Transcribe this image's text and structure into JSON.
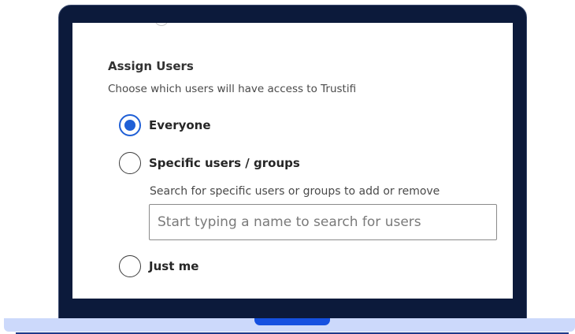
{
  "assign_users": {
    "title": "Assign Users",
    "description": "Choose which users will have access to Trustifi",
    "options": [
      {
        "label": "Everyone",
        "selected": true
      },
      {
        "label": "Specific users / groups",
        "selected": false
      },
      {
        "label": "Just me",
        "selected": false
      }
    ],
    "search": {
      "help_text": "Search for specific users or groups to add or remove",
      "placeholder": "Start typing a name to search for users",
      "value": ""
    }
  },
  "colors": {
    "laptop_frame": "#0c1a3b",
    "laptop_base": "#ccd9fb",
    "notch": "#1550e0",
    "radio_accent": "#1f5fd6"
  }
}
